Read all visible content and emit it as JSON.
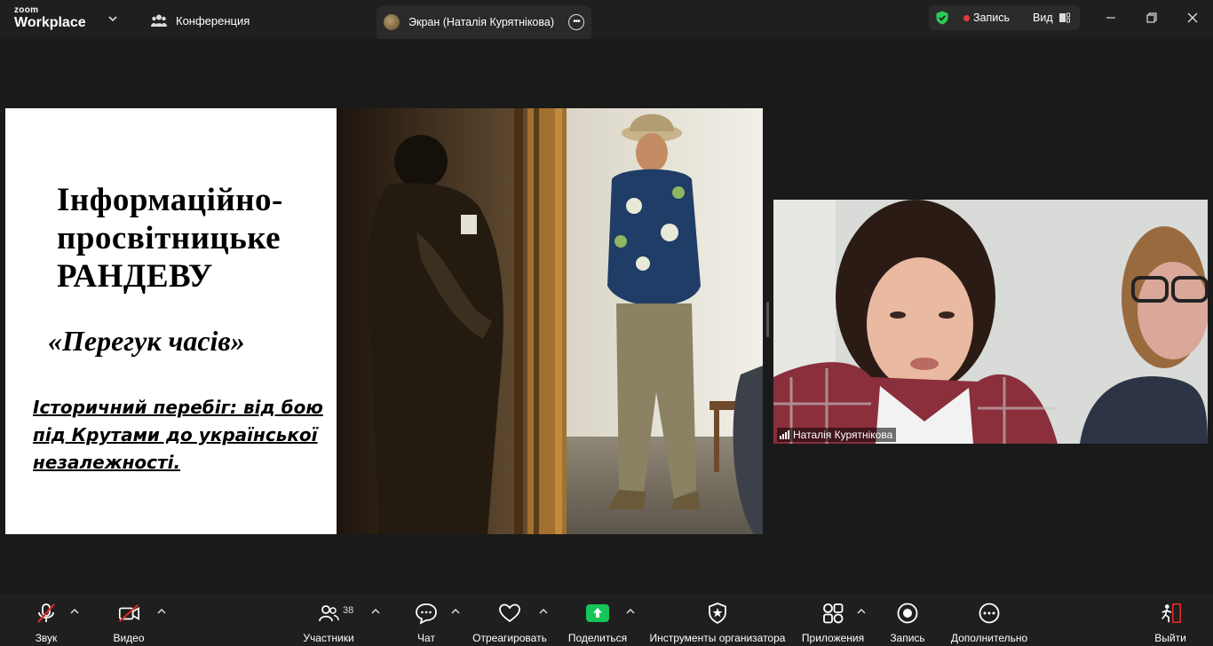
{
  "app": {
    "brand_small": "zoom",
    "brand_large": "Workplace"
  },
  "tabs": [
    {
      "label": "Конференция"
    },
    {
      "label": "Экран (Наталія Курятнікова)"
    }
  ],
  "recording": {
    "label": "Запись",
    "view_label": "Вид"
  },
  "slide": {
    "title_line1": "Інформаційно-",
    "title_line2": "просвітницьке",
    "title_line3": "РАНДЕВУ",
    "subtitle": "«Перегук часів»",
    "description": "Історичний перебіг: від бою під Крутами до української незалежності."
  },
  "participant": {
    "name": "Наталія Курятнікова"
  },
  "toolbar": {
    "audio": "Звук",
    "video": "Видео",
    "participants": "Участники",
    "participants_count": "38",
    "chat": "Чат",
    "react": "Отреагировать",
    "share": "Поделиться",
    "host_tools": "Инструменты организатора",
    "apps": "Приложения",
    "record": "Запись",
    "more": "Дополнительно",
    "leave": "Выйти"
  },
  "colors": {
    "share_green": "#16c45a",
    "record_red": "#e43b3b",
    "shield_green": "#2ecc58",
    "leave_red": "#e02828"
  }
}
